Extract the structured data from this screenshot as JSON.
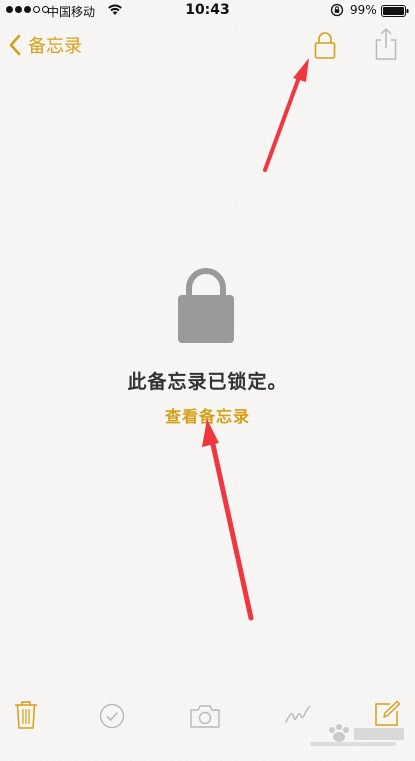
{
  "status_bar": {
    "carrier": "中国移动",
    "time": "10:43",
    "battery_percent": "99%"
  },
  "nav": {
    "back_label": "备忘录"
  },
  "content": {
    "locked_message": "此备忘录已锁定。",
    "view_note_label": "查看备忘录"
  },
  "colors": {
    "accent": "#d4a017",
    "lock_gray": "#9a9a9a",
    "annotation_red": "#f0363f"
  },
  "icons": {
    "nav": [
      "lock-icon",
      "share-icon"
    ],
    "toolbar": [
      "trash-icon",
      "checklist-icon",
      "camera-icon",
      "sketch-icon",
      "compose-icon"
    ]
  }
}
